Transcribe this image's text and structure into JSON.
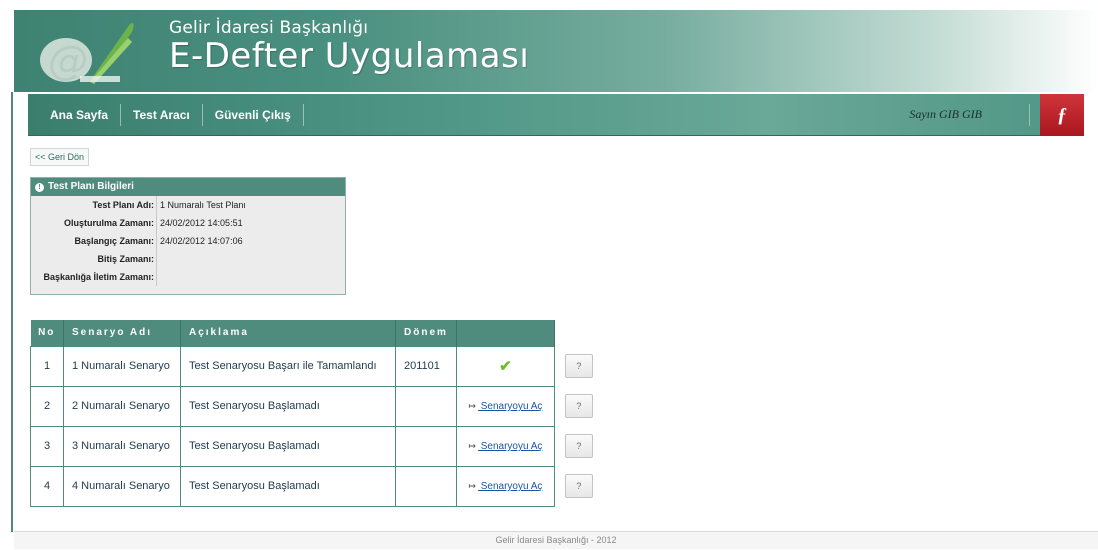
{
  "header": {
    "org_name": "Gelir İdaresi Başkanlığı",
    "app_title": "E-Defter Uygulaması"
  },
  "nav": {
    "items": [
      {
        "label": "Ana Sayfa"
      },
      {
        "label": "Test Aracı"
      },
      {
        "label": "Güvenli Çıkış"
      }
    ],
    "user_label": "Sayın GIB GIB"
  },
  "back_link": "<< Geri Dön",
  "info": {
    "title": "Test Planı Bilgileri",
    "rows": [
      {
        "label": "Test Planı Adı:",
        "value": "1 Numaralı Test Planı"
      },
      {
        "label": "Oluşturulma Zamanı:",
        "value": "24/02/2012 14:05:51"
      },
      {
        "label": "Başlangıç Zamanı:",
        "value": "24/02/2012 14:07:06"
      },
      {
        "label": "Bitiş Zamanı:",
        "value": ""
      },
      {
        "label": "Başkanlığa İletim Zamanı:",
        "value": ""
      }
    ]
  },
  "table": {
    "headers": {
      "no": "No",
      "name": "Senaryo Adı",
      "desc": "Açıklama",
      "donem": "Dönem",
      "action": ""
    },
    "rows": [
      {
        "no": "1",
        "name": "1 Numaralı Senaryo",
        "desc": "Test Senaryosu Başarı ile Tamamlandı",
        "donem": "201101",
        "action": "",
        "status": "completed"
      },
      {
        "no": "2",
        "name": "2 Numaralı Senaryo",
        "desc": "Test Senaryosu Başlamadı",
        "donem": "",
        "action": " Senaryoyu Aç",
        "status": "not-started"
      },
      {
        "no": "3",
        "name": "3 Numaralı Senaryo",
        "desc": "Test Senaryosu Başlamadı",
        "donem": "",
        "action": " Senaryoyu Aç",
        "status": "not-started"
      },
      {
        "no": "4",
        "name": "4 Numaralı Senaryo",
        "desc": "Test Senaryosu Başlamadı",
        "donem": "",
        "action": " Senaryoyu Aç",
        "status": "not-started"
      }
    ],
    "help_label": "?"
  },
  "footer": "Gelir İdaresi Başkanlığı - 2012",
  "colors": {
    "accent": "#4f8c7d",
    "exit": "#c1252d",
    "link": "#1a56a8",
    "check": "#6fbd2e"
  },
  "icons": {
    "info": "info-icon",
    "check": "check-icon",
    "open": "open-icon",
    "exit": "exit-icon",
    "logo": "gib-logo"
  }
}
